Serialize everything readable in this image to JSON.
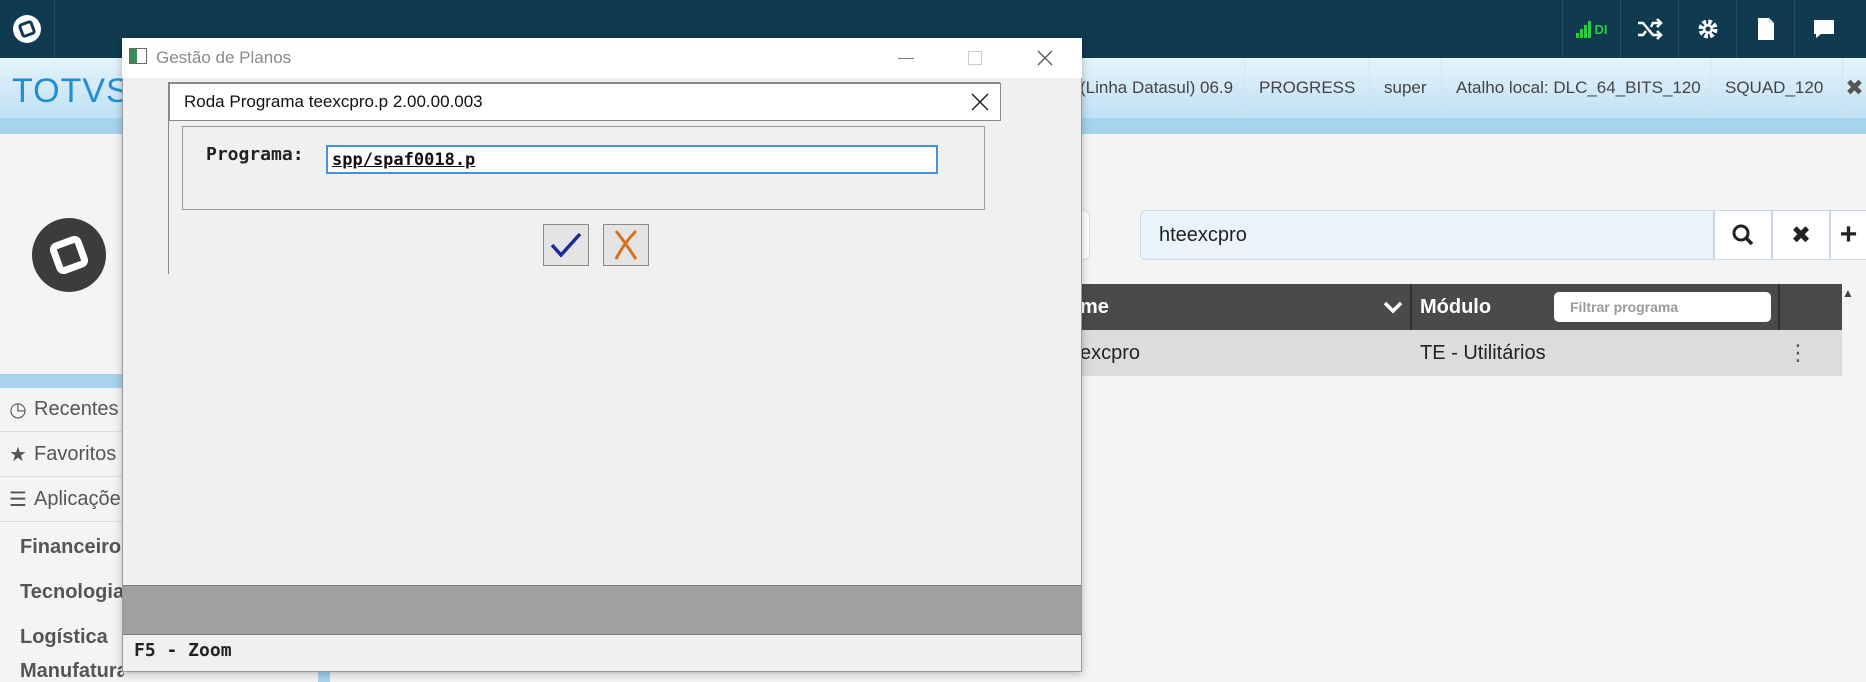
{
  "topbar": {
    "signal_label": "DI"
  },
  "menubar": {
    "brand": "TOTVS",
    "crumbs": [
      "(Linha Datasul) 06.9",
      "PROGRESS",
      "super",
      "Atalho local: DLC_64_BITS_120",
      "SQUAD_120"
    ]
  },
  "sidebar": {
    "items": [
      {
        "label": "Recentes",
        "icon": "clock-icon"
      },
      {
        "label": "Favoritos",
        "icon": "star-icon"
      },
      {
        "label": "Aplicaçõe",
        "icon": "menu-icon"
      }
    ],
    "subitems": [
      "Financeiro",
      "Tecnologia",
      "Logística",
      "Manufatura"
    ]
  },
  "search": {
    "value": "hteexcpro"
  },
  "table": {
    "headers": {
      "name": "me",
      "module": "Módulo"
    },
    "filter_placeholder": "Filtrar programa",
    "rows": [
      {
        "name": "excpro",
        "module": "TE - Utilitários"
      }
    ]
  },
  "outer_dialog": {
    "title": "Gestão de Planos",
    "status": "F5 - Zoom"
  },
  "inner_dialog": {
    "title": "Roda Programa teexcpro.p  2.00.00.003",
    "field_label": "Programa:",
    "field_value": "spp/spaf0018.p"
  },
  "colors": {
    "topbar": "#103a4f",
    "accent": "#1f8fd2",
    "signal": "#2ecc40",
    "confirm": "#1a2a9c",
    "cancel": "#d4701c"
  }
}
